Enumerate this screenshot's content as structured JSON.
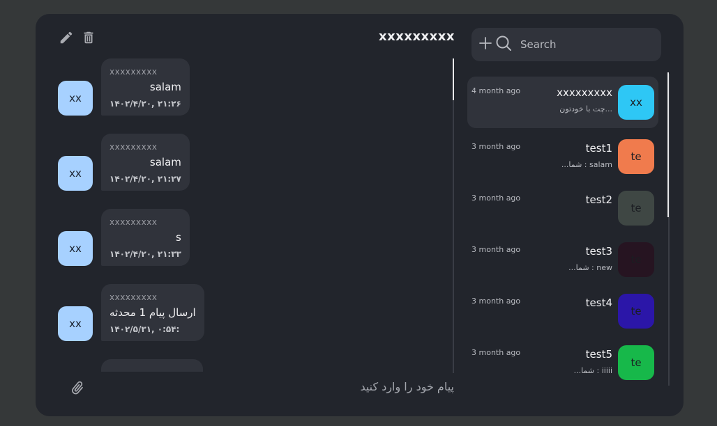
{
  "chat": {
    "title": "xxxxxxxxx",
    "messages": [
      {
        "sender": "xxxxxxxxx",
        "text": "salam",
        "time": "۱۴۰۲/۴/۲۰, ۲۱:۲۶",
        "avatar": "xx"
      },
      {
        "sender": "xxxxxxxxx",
        "text": "salam",
        "time": "۱۴۰۲/۴/۲۰, ۲۱:۲۷",
        "avatar": "xx"
      },
      {
        "sender": "xxxxxxxxx",
        "text": "s",
        "time": "۱۴۰۲/۴/۲۰, ۲۱:۳۳",
        "avatar": "xx"
      },
      {
        "sender": "xxxxxxxxx",
        "text": "ارسال پیام 1 محدثه",
        "time": "۱۴۰۲/۵/۳۱, ۰:۵۴:",
        "avatar": "xx"
      }
    ],
    "composer_placeholder": "پیام خود را وارد کنید"
  },
  "search": {
    "placeholder": "Search"
  },
  "contacts": [
    {
      "name": "xxxxxxxxx",
      "preview": "...چت با خودتون",
      "time": "4 month ago",
      "avatar": "xx",
      "color": "#2ec7f5",
      "active": true
    },
    {
      "name": "test1",
      "preview": "salam : شما...",
      "time": "3 month ago",
      "avatar": "te",
      "color": "#f07b4d",
      "active": false
    },
    {
      "name": "test2",
      "preview": "",
      "time": "3 month ago",
      "avatar": "te",
      "color": "#3f4744",
      "active": false
    },
    {
      "name": "test3",
      "preview": "new : شما...",
      "time": "3 month ago",
      "avatar": "te",
      "color": "#261421",
      "active": false
    },
    {
      "name": "test4",
      "preview": "",
      "time": "3 month ago",
      "avatar": "te",
      "color": "#2b16a8",
      "active": false
    },
    {
      "name": "test5",
      "preview": "iiiii : شما...",
      "time": "3 month ago",
      "avatar": "te",
      "color": "#17b84a",
      "active": false
    }
  ]
}
